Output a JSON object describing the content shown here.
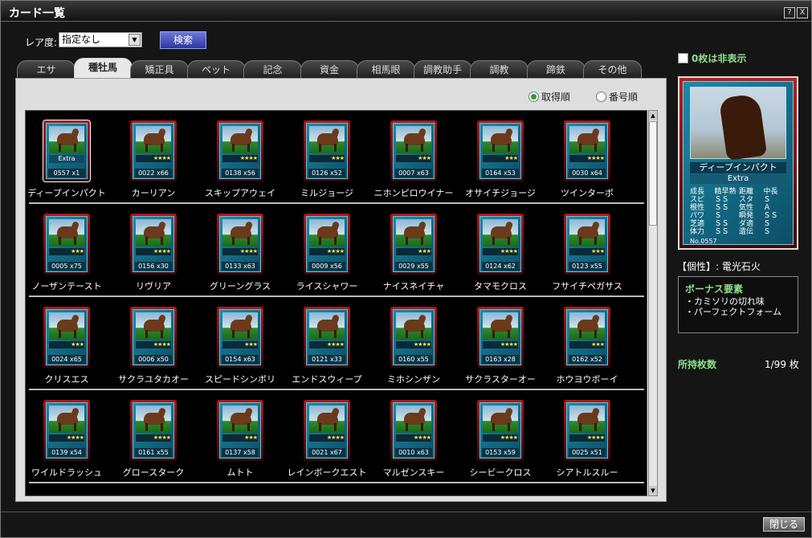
{
  "window": {
    "title": "カード一覧",
    "help_label": "?",
    "close_label": "X"
  },
  "filter": {
    "rarity_label": "レア度:",
    "rarity_value": "指定なし",
    "search_label": "検索"
  },
  "tabs": [
    "エサ",
    "種牡馬",
    "矯正具",
    "ペット",
    "記念",
    "資金",
    "相馬眼",
    "調教助手",
    "調教",
    "蹄鉄",
    "その他"
  ],
  "active_tab": 1,
  "sort": {
    "acquired_label": "取得順",
    "number_label": "番号順"
  },
  "cards": [
    {
      "name": "ディープインパクト",
      "no": "0557",
      "count": "x1",
      "stars": "",
      "extra": "Extra"
    },
    {
      "name": "カーリアン",
      "no": "0022",
      "count": "x66",
      "stars": "★★★★"
    },
    {
      "name": "スキップアウェイ",
      "no": "0138",
      "count": "x56",
      "stars": "★★★★"
    },
    {
      "name": "ミルジョージ",
      "no": "0126",
      "count": "x52",
      "stars": "★★★"
    },
    {
      "name": "ニホンピロウイナー",
      "no": "0007",
      "count": "x63",
      "stars": "★★★"
    },
    {
      "name": "オサイチジョージ",
      "no": "0164",
      "count": "x53",
      "stars": "★★★"
    },
    {
      "name": "ツインターボ",
      "no": "0030",
      "count": "x64",
      "stars": "★★★★"
    },
    {
      "name": "ノーザンテースト",
      "no": "0005",
      "count": "x75",
      "stars": "★★★"
    },
    {
      "name": "リヴリア",
      "no": "0156",
      "count": "x30",
      "stars": "★★★★"
    },
    {
      "name": "グリーングラス",
      "no": "0133",
      "count": "x63",
      "stars": "★★★★"
    },
    {
      "name": "ライスシャワー",
      "no": "0009",
      "count": "x56",
      "stars": "★★★★"
    },
    {
      "name": "ナイスネイチャ",
      "no": "0029",
      "count": "x55",
      "stars": "★★★"
    },
    {
      "name": "タマモクロス",
      "no": "0124",
      "count": "x62",
      "stars": "★★★★"
    },
    {
      "name": "フサイチペガサス",
      "no": "0123",
      "count": "x55",
      "stars": "★★★"
    },
    {
      "name": "クリスエス",
      "no": "0024",
      "count": "x65",
      "stars": "★★★"
    },
    {
      "name": "サクラユタカオー",
      "no": "0006",
      "count": "x50",
      "stars": "★★★★"
    },
    {
      "name": "スピードシンボリ",
      "no": "0154",
      "count": "x63",
      "stars": "★★★"
    },
    {
      "name": "エンドスウィープ",
      "no": "0121",
      "count": "x33",
      "stars": "★★★★"
    },
    {
      "name": "ミホシンザン",
      "no": "0160",
      "count": "x55",
      "stars": "★★★★"
    },
    {
      "name": "サクラスターオー",
      "no": "0163",
      "count": "x28",
      "stars": "★★★★"
    },
    {
      "name": "ホウヨウボーイ",
      "no": "0162",
      "count": "x52",
      "stars": "★★★"
    },
    {
      "name": "ワイルドラッシュ",
      "no": "0139",
      "count": "x54",
      "stars": "★★★★"
    },
    {
      "name": "グロースターク",
      "no": "0161",
      "count": "x55",
      "stars": "★★★★"
    },
    {
      "name": "ムトト",
      "no": "0137",
      "count": "x58",
      "stars": "★★★"
    },
    {
      "name": "レインボークエスト",
      "no": "0021",
      "count": "x67",
      "stars": "★★★★"
    },
    {
      "name": "マルゼンスキー",
      "no": "0010",
      "count": "x63",
      "stars": "★★★★"
    },
    {
      "name": "シービークロス",
      "no": "0153",
      "count": "x59",
      "stars": "★★★★"
    },
    {
      "name": "シアトルスルー",
      "no": "0025",
      "count": "x51",
      "stars": "★★★★"
    }
  ],
  "detail": {
    "hide_zero_label": "0枚は非表示",
    "name": "ディープインパクト",
    "rarity": "Extra",
    "stats": [
      [
        "成長",
        "精早熟",
        "距離",
        "中長"
      ],
      [
        "スピ",
        "ＳＳ",
        "スタ",
        "Ｓ"
      ],
      [
        "根性",
        "ＳＳ",
        "気性",
        "Ａ"
      ],
      [
        "パワ",
        "Ｓ",
        "瞬発",
        "ＳＳ"
      ],
      [
        "芝適",
        "ＳＳ",
        "ダ適",
        "Ｓ"
      ],
      [
        "体力",
        "ＳＳ",
        "遺伝",
        "Ｓ"
      ]
    ],
    "no": "No.0557",
    "trait": "【個性】: 電光石火",
    "bonus_title": "ボーナス要素",
    "bonus_items": [
      "・カミソリの切れ味",
      "・パーフェクトフォーム"
    ],
    "owned_label": "所持枚数",
    "owned_value": "1/99 枚"
  },
  "footer": {
    "close_label": "閉じる"
  }
}
